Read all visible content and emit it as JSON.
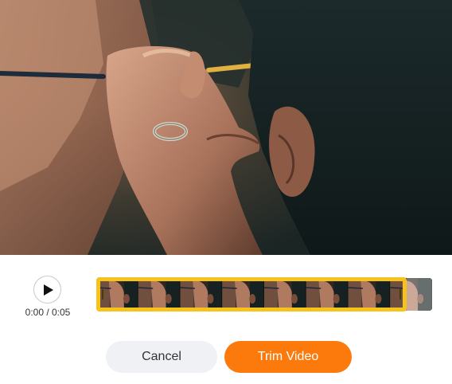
{
  "player": {
    "current_time": "0:00",
    "duration": "0:05",
    "time_display": "0:00 / 0:05",
    "play_icon": "play-icon"
  },
  "trim": {
    "selection_start": 0.0,
    "selection_end": 0.92,
    "accent_color": "#f6c21c",
    "thumbnail_count": 8
  },
  "actions": {
    "cancel_label": "Cancel",
    "trim_label": "Trim Video",
    "primary_color": "#fb7a0b"
  }
}
